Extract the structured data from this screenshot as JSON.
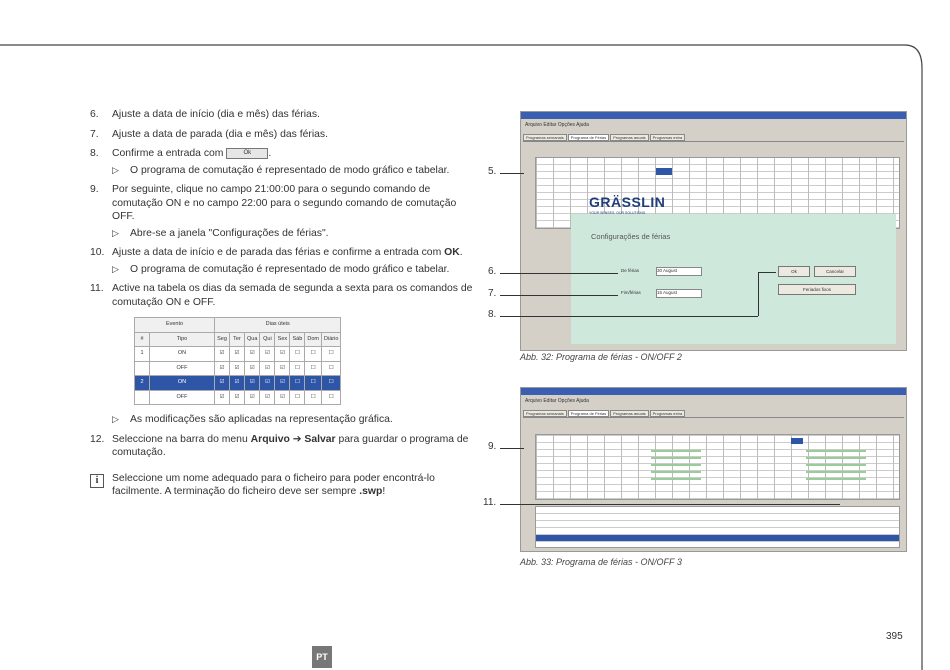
{
  "steps": [
    {
      "num": "6.",
      "text": "Ajuste a data de início (dia e mês) das férias."
    },
    {
      "num": "7.",
      "text": "Ajuste a data de parada (dia e mês) das férias."
    },
    {
      "num": "8.",
      "text": "Confirme a entrada com",
      "button": "Ok",
      "after": ".",
      "sub": "O programa de comutação é representado de modo gráfico e tabelar."
    },
    {
      "num": "9.",
      "text": "Por seguinte, clique no campo 21:00:00 para o segundo comando de comutação ON e no campo 22:00 para o segundo comando de comutação OFF.",
      "sub": "Abre-se a janela \"Configurações de férias\"."
    },
    {
      "num": "10.",
      "text_pre": "Ajuste a data de início e de parada das férias e confirme a entrada com",
      "bold": "OK",
      "after": ".",
      "sub": "O programa de comutação é representado de modo gráfico e tabelar."
    },
    {
      "num": "11.",
      "text": "Active na tabela os dias da semada de segunda a sexta para os comandos de comutação ON e OFF.",
      "sub": "As modificações são aplicadas na representação gráfica."
    },
    {
      "num": "12.",
      "pre": "Seleccione na barra do menu",
      "bold1": "Arquivo",
      "arrow": "➔",
      "bold2": "Salvar",
      "post": "para guardar o programa de comutação."
    }
  ],
  "note": {
    "pre": "Seleccione um nome adequado para o ficheiro para poder encontrá-lo facilmente. A terminação do ficheiro deve ser sempre",
    "bold": ".swp",
    "post": "!"
  },
  "mini_table": {
    "group1": "Evento",
    "group2": "Dias úteis",
    "headers": [
      "#",
      "Tipo",
      "Seg",
      "Ter",
      "Qua",
      "Qui",
      "Sex",
      "Sáb",
      "Dom",
      "Diário"
    ],
    "rows": [
      [
        "1",
        "ON"
      ],
      [
        "",
        "OFF"
      ],
      [
        "2",
        "ON"
      ],
      [
        "",
        "OFF"
      ]
    ]
  },
  "figure1": {
    "menu": "Arquivo  Editar  Opções  Ajuda",
    "tabs": [
      "Programas semanais",
      "Programa de Férias",
      "Programas anuais",
      "Programas extra"
    ],
    "logo": "GRÄSSLIN",
    "tagline": "YOUR SENSES. OUR SOLUTIONS.",
    "dialog_title": "Configurações de férias",
    "field1_label": "De férias",
    "field1_value": "30   August",
    "field2_label": "Fim/férias",
    "field2_value": "15   August",
    "ok": "Ok",
    "cancel": "Cancelar",
    "holidays": "Feriados fixos",
    "caption": "Abb. 32:  Programa de férias  - ON/OFF 2"
  },
  "figure2": {
    "menu": "Arquivo  Editar  Opções  Ajuda",
    "tabs": [
      "Programas semanais",
      "Programa de Férias",
      "Programas anuais",
      "Programas extra"
    ],
    "caption": "Abb. 33:  Programa de férias  - ON/OFF 3"
  },
  "callouts": {
    "c5": "5.",
    "c6": "6.",
    "c7": "7.",
    "c8": "8.",
    "c9": "9.",
    "c11": "11."
  },
  "page_number": "395",
  "lang_badge": "PT"
}
